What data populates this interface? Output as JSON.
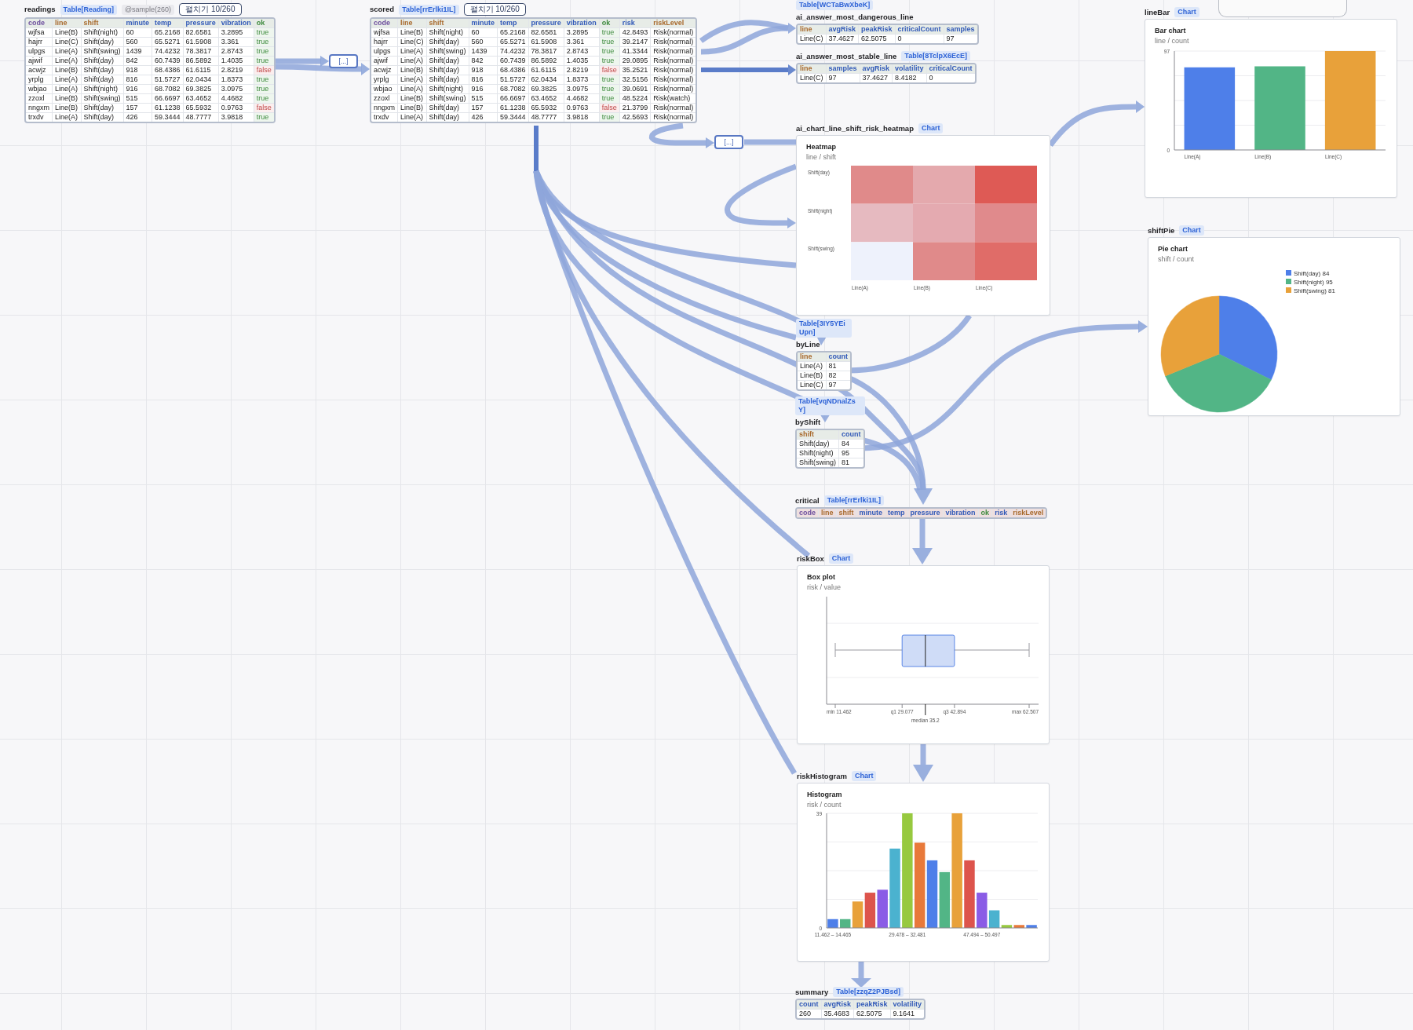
{
  "canvas": {
    "nodes": [
      {
        "kind": "table",
        "name": "readings",
        "badges": [
          {
            "kind": "type",
            "text": "Table[Reading]"
          },
          {
            "kind": "tag",
            "text": "@sample(260)"
          },
          {
            "kind": "button",
            "text": "펼치기 10/260"
          }
        ],
        "table": {
          "columns": [
            {
              "name": "code",
              "kind": "id"
            },
            {
              "name": "line",
              "kind": "enum"
            },
            {
              "name": "shift",
              "kind": "enum"
            },
            {
              "name": "minute",
              "kind": "number"
            },
            {
              "name": "temp",
              "kind": "number"
            },
            {
              "name": "pressure",
              "kind": "number"
            },
            {
              "name": "vibration",
              "kind": "number"
            },
            {
              "name": "ok",
              "kind": "bool"
            }
          ],
          "rows": [
            {
              "cells": [
                "wjfsa",
                "Line(B)",
                "Shift(night)",
                "60",
                "65.2168",
                "82.6581",
                "3.2895",
                "true"
              ],
              "ok": true
            },
            {
              "cells": [
                "hajrr",
                "Line(C)",
                "Shift(day)",
                "560",
                "65.5271",
                "61.5908",
                "3.361",
                "true"
              ],
              "ok": true
            },
            {
              "cells": [
                "ulpgs",
                "Line(A)",
                "Shift(swing)",
                "1439",
                "74.4232",
                "78.3817",
                "2.8743",
                "true"
              ],
              "ok": true
            },
            {
              "cells": [
                "ajwif",
                "Line(A)",
                "Shift(day)",
                "842",
                "60.7439",
                "86.5892",
                "1.4035",
                "true"
              ],
              "ok": true
            },
            {
              "cells": [
                "acwjz",
                "Line(B)",
                "Shift(day)",
                "918",
                "68.4386",
                "61.6115",
                "2.8219",
                "false"
              ],
              "ok": false
            },
            {
              "cells": [
                "yrplg",
                "Line(A)",
                "Shift(day)",
                "816",
                "51.5727",
                "62.0434",
                "1.8373",
                "true"
              ],
              "ok": true
            },
            {
              "cells": [
                "wbjao",
                "Line(A)",
                "Shift(night)",
                "916",
                "68.7082",
                "69.3825",
                "3.0975",
                "true"
              ],
              "ok": true
            },
            {
              "cells": [
                "zzoxl",
                "Line(B)",
                "Shift(swing)",
                "515",
                "66.6697",
                "63.4652",
                "4.4682",
                "true"
              ],
              "ok": true
            },
            {
              "cells": [
                "nngxm",
                "Line(B)",
                "Shift(day)",
                "157",
                "61.1238",
                "65.5932",
                "0.9763",
                "false"
              ],
              "ok": false
            },
            {
              "cells": [
                "trxdv",
                "Line(A)",
                "Shift(day)",
                "426",
                "59.3444",
                "48.7777",
                "3.9818",
                "true"
              ],
              "ok": true
            }
          ]
        }
      },
      {
        "kind": "collapsed",
        "text": "[...]"
      },
      {
        "kind": "table",
        "name": "scored",
        "badges": [
          {
            "kind": "type",
            "text": "Table[rrErlki1IL]"
          },
          {
            "kind": "button",
            "text": "펼치기 10/260"
          }
        ],
        "table": {
          "columns": [
            {
              "name": "code",
              "kind": "id"
            },
            {
              "name": "line",
              "kind": "enum"
            },
            {
              "name": "shift",
              "kind": "enum"
            },
            {
              "name": "minute",
              "kind": "number"
            },
            {
              "name": "temp",
              "kind": "number"
            },
            {
              "name": "pressure",
              "kind": "number"
            },
            {
              "name": "vibration",
              "kind": "number"
            },
            {
              "name": "ok",
              "kind": "bool"
            },
            {
              "name": "risk",
              "kind": "number"
            },
            {
              "name": "riskLevel",
              "kind": "enum"
            }
          ],
          "rows": [
            {
              "cells": [
                "wjfsa",
                "Line(B)",
                "Shift(night)",
                "60",
                "65.2168",
                "82.6581",
                "3.2895",
                "true",
                "42.8493",
                "Risk(normal)"
              ],
              "ok": true
            },
            {
              "cells": [
                "hajrr",
                "Line(C)",
                "Shift(day)",
                "560",
                "65.5271",
                "61.5908",
                "3.361",
                "true",
                "39.2147",
                "Risk(normal)"
              ],
              "ok": true
            },
            {
              "cells": [
                "ulpgs",
                "Line(A)",
                "Shift(swing)",
                "1439",
                "74.4232",
                "78.3817",
                "2.8743",
                "true",
                "41.3344",
                "Risk(normal)"
              ],
              "ok": true
            },
            {
              "cells": [
                "ajwif",
                "Line(A)",
                "Shift(day)",
                "842",
                "60.7439",
                "86.5892",
                "1.4035",
                "true",
                "29.0895",
                "Risk(normal)"
              ],
              "ok": true
            },
            {
              "cells": [
                "acwjz",
                "Line(B)",
                "Shift(day)",
                "918",
                "68.4386",
                "61.6115",
                "2.8219",
                "false",
                "35.2521",
                "Risk(normal)"
              ],
              "ok": false
            },
            {
              "cells": [
                "yrplg",
                "Line(A)",
                "Shift(day)",
                "816",
                "51.5727",
                "62.0434",
                "1.8373",
                "true",
                "32.5156",
                "Risk(normal)"
              ],
              "ok": true
            },
            {
              "cells": [
                "wbjao",
                "Line(A)",
                "Shift(night)",
                "916",
                "68.7082",
                "69.3825",
                "3.0975",
                "true",
                "39.0691",
                "Risk(normal)"
              ],
              "ok": true
            },
            {
              "cells": [
                "zzoxl",
                "Line(B)",
                "Shift(swing)",
                "515",
                "66.6697",
                "63.4652",
                "4.4682",
                "true",
                "48.5224",
                "Risk(watch)"
              ],
              "ok": true
            },
            {
              "cells": [
                "nngxm",
                "Line(B)",
                "Shift(day)",
                "157",
                "61.1238",
                "65.5932",
                "0.9763",
                "false",
                "21.3799",
                "Risk(normal)"
              ],
              "ok": false
            },
            {
              "cells": [
                "trxdv",
                "Line(A)",
                "Shift(day)",
                "426",
                "59.3444",
                "48.7777",
                "3.9818",
                "true",
                "42.5693",
                "Risk(normal)"
              ],
              "ok": true
            }
          ]
        }
      },
      {
        "kind": "collapsed",
        "text": "[...]"
      },
      {
        "kind": "table",
        "name": "ai_answer_most_dangerous_line",
        "badges": [
          {
            "kind": "type",
            "text": "Table[WCTaBwXbeK]"
          }
        ],
        "table": {
          "columns": [
            {
              "name": "line",
              "kind": "enum"
            },
            {
              "name": "avgRisk",
              "kind": "number"
            },
            {
              "name": "peakRisk",
              "kind": "number"
            },
            {
              "name": "criticalCount",
              "kind": "number"
            },
            {
              "name": "samples",
              "kind": "number"
            }
          ],
          "rows": [
            {
              "cells": [
                "Line(C)",
                "37.4627",
                "62.5075",
                "0",
                "97"
              ]
            }
          ]
        }
      },
      {
        "kind": "table",
        "name": "ai_answer_most_stable_line",
        "badges": [
          {
            "kind": "type",
            "text": "Table[8TclpX6EcE]"
          }
        ],
        "table": {
          "columns": [
            {
              "name": "line",
              "kind": "enum"
            },
            {
              "name": "samples",
              "kind": "number"
            },
            {
              "name": "avgRisk",
              "kind": "number"
            },
            {
              "name": "volatility",
              "kind": "number"
            },
            {
              "name": "criticalCount",
              "kind": "number"
            }
          ],
          "rows": [
            {
              "cells": [
                "Line(C)",
                "97",
                "37.4627",
                "8.4182",
                "0"
              ]
            }
          ]
        }
      },
      {
        "kind": "heatmap",
        "name": "ai_chart_line_shift_risk_heatmap",
        "badges": [
          {
            "kind": "type",
            "text": "Chart"
          }
        ],
        "title": "Heatmap",
        "subtitle": "line / shift",
        "columns": [
          "Line(A)",
          "Line(B)",
          "Line(C)"
        ],
        "rows": [
          {
            "label": "Shift(day)",
            "cells": [
              {
                "color": "#e08a8a"
              },
              {
                "color": "#e4a9ad"
              },
              {
                "color": "#de5a55"
              }
            ]
          },
          {
            "label": "Shift(night)",
            "cells": [
              {
                "color": "#e6bac0"
              },
              {
                "color": "#e4aab0"
              },
              {
                "color": "#e08a8c"
              }
            ]
          },
          {
            "label": "Shift(swing)",
            "cells": [
              {
                "color": "#eef2fc"
              },
              {
                "color": "#e08a8a"
              },
              {
                "color": "#e06c68"
              }
            ]
          }
        ]
      },
      {
        "kind": "table",
        "name": "byLine",
        "badges": [
          {
            "kind": "type",
            "text": "Table[3IY5YEiUpn]"
          }
        ],
        "table": {
          "columns": [
            {
              "name": "line",
              "kind": "enum"
            },
            {
              "name": "count",
              "kind": "number"
            }
          ],
          "rows": [
            {
              "cells": [
                "Line(A)",
                "81"
              ]
            },
            {
              "cells": [
                "Line(B)",
                "82"
              ]
            },
            {
              "cells": [
                "Line(C)",
                "97"
              ]
            }
          ]
        }
      },
      {
        "kind": "table",
        "name": "byShift",
        "badges": [
          {
            "kind": "type",
            "text": "Table[vqNDnalZsY]"
          }
        ],
        "table": {
          "columns": [
            {
              "name": "shift",
              "kind": "enum"
            },
            {
              "name": "count",
              "kind": "number"
            }
          ],
          "rows": [
            {
              "cells": [
                "Shift(day)",
                "84"
              ]
            },
            {
              "cells": [
                "Shift(night)",
                "95"
              ]
            },
            {
              "cells": [
                "Shift(swing)",
                "81"
              ]
            }
          ]
        }
      },
      {
        "kind": "table",
        "name": "critical",
        "badges": [
          {
            "kind": "type",
            "text": "Table[rrErlki1IL]"
          }
        ],
        "table": {
          "columns": [
            {
              "name": "code",
              "kind": "id"
            },
            {
              "name": "line",
              "kind": "enum"
            },
            {
              "name": "shift",
              "kind": "enum"
            },
            {
              "name": "minute",
              "kind": "number"
            },
            {
              "name": "temp",
              "kind": "number"
            },
            {
              "name": "pressure",
              "kind": "number"
            },
            {
              "name": "vibration",
              "kind": "number"
            },
            {
              "name": "ok",
              "kind": "bool"
            },
            {
              "name": "risk",
              "kind": "number"
            },
            {
              "name": "riskLevel",
              "kind": "enum"
            }
          ]
        }
      },
      {
        "kind": "boxplot",
        "name": "riskBox",
        "badges": [
          {
            "kind": "type",
            "text": "Chart"
          }
        ],
        "title": "Box plot",
        "subtitle": "risk / value",
        "axis_labels": [
          "min 11.462",
          "q1 29.077",
          "q3 42.894",
          "max 62.507"
        ],
        "median_label": "median 35.2"
      },
      {
        "kind": "chart",
        "name": "riskHistogram",
        "badges": [
          {
            "kind": "type",
            "text": "Chart"
          }
        ],
        "subtitle": "risk / count",
        "chart_data": {
          "type": "bar",
          "title": "Histogram",
          "categories": [
            "11.462 – 14.465",
            null,
            null,
            null,
            null,
            null,
            "29.478 – 32.481",
            null,
            null,
            null,
            null,
            null,
            "47.494 – 50.497",
            null,
            null,
            null,
            null
          ],
          "values": [
            3,
            3,
            9,
            12,
            13,
            27,
            39,
            29,
            23,
            19,
            39,
            23,
            12,
            6,
            1,
            1,
            1
          ],
          "ylim": [
            0,
            39
          ],
          "yticks": [
            0,
            39
          ]
        }
      },
      {
        "kind": "table",
        "name": "summary",
        "badges": [
          {
            "kind": "type",
            "text": "Table[zzqZ2PJBsd]"
          }
        ],
        "table": {
          "columns": [
            {
              "name": "count",
              "kind": "number"
            },
            {
              "name": "avgRisk",
              "kind": "number"
            },
            {
              "name": "peakRisk",
              "kind": "number"
            },
            {
              "name": "volatility",
              "kind": "number"
            }
          ],
          "rows": [
            {
              "cells": [
                "260",
                "35.4683",
                "62.5075",
                "9.1641"
              ]
            }
          ]
        }
      },
      {
        "kind": "chart",
        "name": "lineBar",
        "badges": [
          {
            "kind": "type",
            "text": "Chart"
          }
        ],
        "subtitle": "line / count",
        "chart_data": {
          "type": "bar",
          "title": "Bar chart",
          "categories": [
            "Line(A)",
            "Line(B)",
            "Line(C)"
          ],
          "values": [
            81,
            82,
            97
          ],
          "ylim": [
            0,
            97
          ],
          "yticks": [
            0,
            97
          ]
        }
      },
      {
        "kind": "chart",
        "name": "shiftPie",
        "badges": [
          {
            "kind": "type",
            "text": "Chart"
          }
        ],
        "subtitle": "shift / count",
        "chart_data": {
          "type": "pie",
          "title": "Pie chart",
          "categories": [
            "Shift(day) 84",
            "Shift(night) 95",
            "Shift(swing) 81"
          ],
          "values": [
            84,
            95,
            81
          ],
          "legend": "right"
        }
      }
    ]
  }
}
